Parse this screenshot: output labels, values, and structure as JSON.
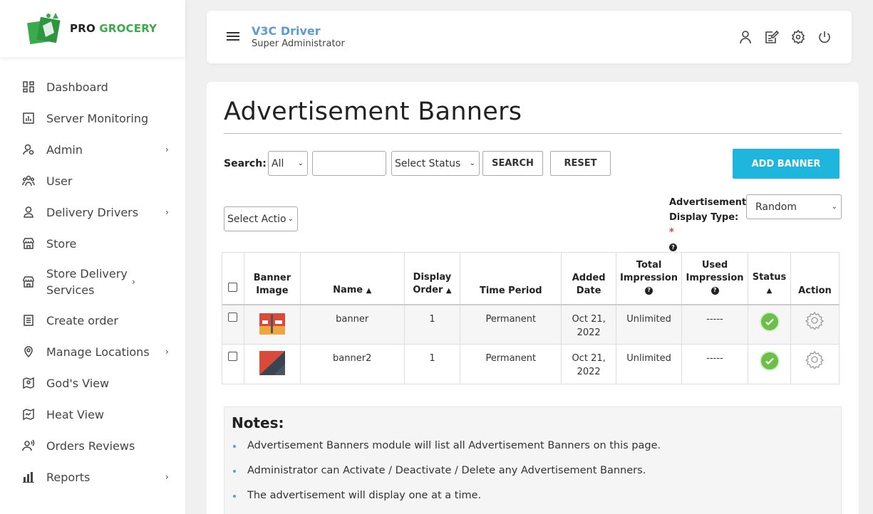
{
  "brand": {
    "pro": "PRO",
    "grocery": "GROCERY"
  },
  "sidebar": {
    "items": [
      {
        "label": "Dashboard",
        "icon": "dashboard-icon",
        "has_submenu": false
      },
      {
        "label": "Server Monitoring",
        "icon": "chart-icon",
        "has_submenu": false
      },
      {
        "label": "Admin",
        "icon": "admin-icon",
        "has_submenu": true
      },
      {
        "label": "User",
        "icon": "users-icon",
        "has_submenu": false
      },
      {
        "label": "Delivery Drivers",
        "icon": "driver-icon",
        "has_submenu": true
      },
      {
        "label": "Store",
        "icon": "store-icon",
        "has_submenu": false
      },
      {
        "label": "Store Delivery Services",
        "icon": "store-icon",
        "has_submenu": true
      },
      {
        "label": "Create order",
        "icon": "order-icon",
        "has_submenu": false
      },
      {
        "label": "Manage Locations",
        "icon": "location-icon",
        "has_submenu": true
      },
      {
        "label": "God's View",
        "icon": "map-icon",
        "has_submenu": false
      },
      {
        "label": "Heat View",
        "icon": "heatmap-icon",
        "has_submenu": false
      },
      {
        "label": "Orders Reviews",
        "icon": "review-icon",
        "has_submenu": false
      },
      {
        "label": "Reports",
        "icon": "bar-chart-icon",
        "has_submenu": true
      }
    ]
  },
  "header": {
    "user_name": "V3C Driver",
    "user_role": "Super Administrator",
    "icons": [
      "profile-icon",
      "edit-icon",
      "settings-icon",
      "power-icon"
    ]
  },
  "page": {
    "title": "Advertisement Banners",
    "search_label": "Search:",
    "search_scope": "All",
    "search_value": "",
    "status_select": "Select Status",
    "search_button": "SEARCH",
    "reset_button": "RESET",
    "add_button": "ADD BANNER",
    "action_select": "Select Actio",
    "display_type_label_1": "Advertisement",
    "display_type_label_2": "Display Type:",
    "required_mark": "*",
    "display_type_value": "Random"
  },
  "table": {
    "headers": {
      "banner_image": [
        "Banner",
        "Image"
      ],
      "name": "Name",
      "display_order": [
        "Display",
        "Order"
      ],
      "time_period": "Time Period",
      "added_date": [
        "Added",
        "Date"
      ],
      "total_impression": [
        "Total",
        "Impression"
      ],
      "used_impression": [
        "Used",
        "Impression"
      ],
      "status": "Status",
      "action": "Action"
    },
    "rows": [
      {
        "name": "banner",
        "display_order": "1",
        "time_period": "Permanent",
        "added_date": [
          "Oct 21,",
          "2022"
        ],
        "total_impression": "Unlimited",
        "used_impression": "-----",
        "status": "active"
      },
      {
        "name": "banner2",
        "display_order": "1",
        "time_period": "Permanent",
        "added_date": [
          "Oct 21,",
          "2022"
        ],
        "total_impression": "Unlimited",
        "used_impression": "-----",
        "status": "active"
      }
    ]
  },
  "notes": {
    "title": "Notes:",
    "items": [
      "Advertisement Banners module will list all Advertisement Banners on this page.",
      "Administrator can Activate / Deactivate / Delete any Advertisement Banners.",
      "The advertisement will display one at a time."
    ]
  },
  "colors": {
    "accent": "#1fb6de",
    "brand_green": "#3aab4d",
    "link_blue": "#5b9bd5",
    "status_green": "#6cc04a"
  }
}
